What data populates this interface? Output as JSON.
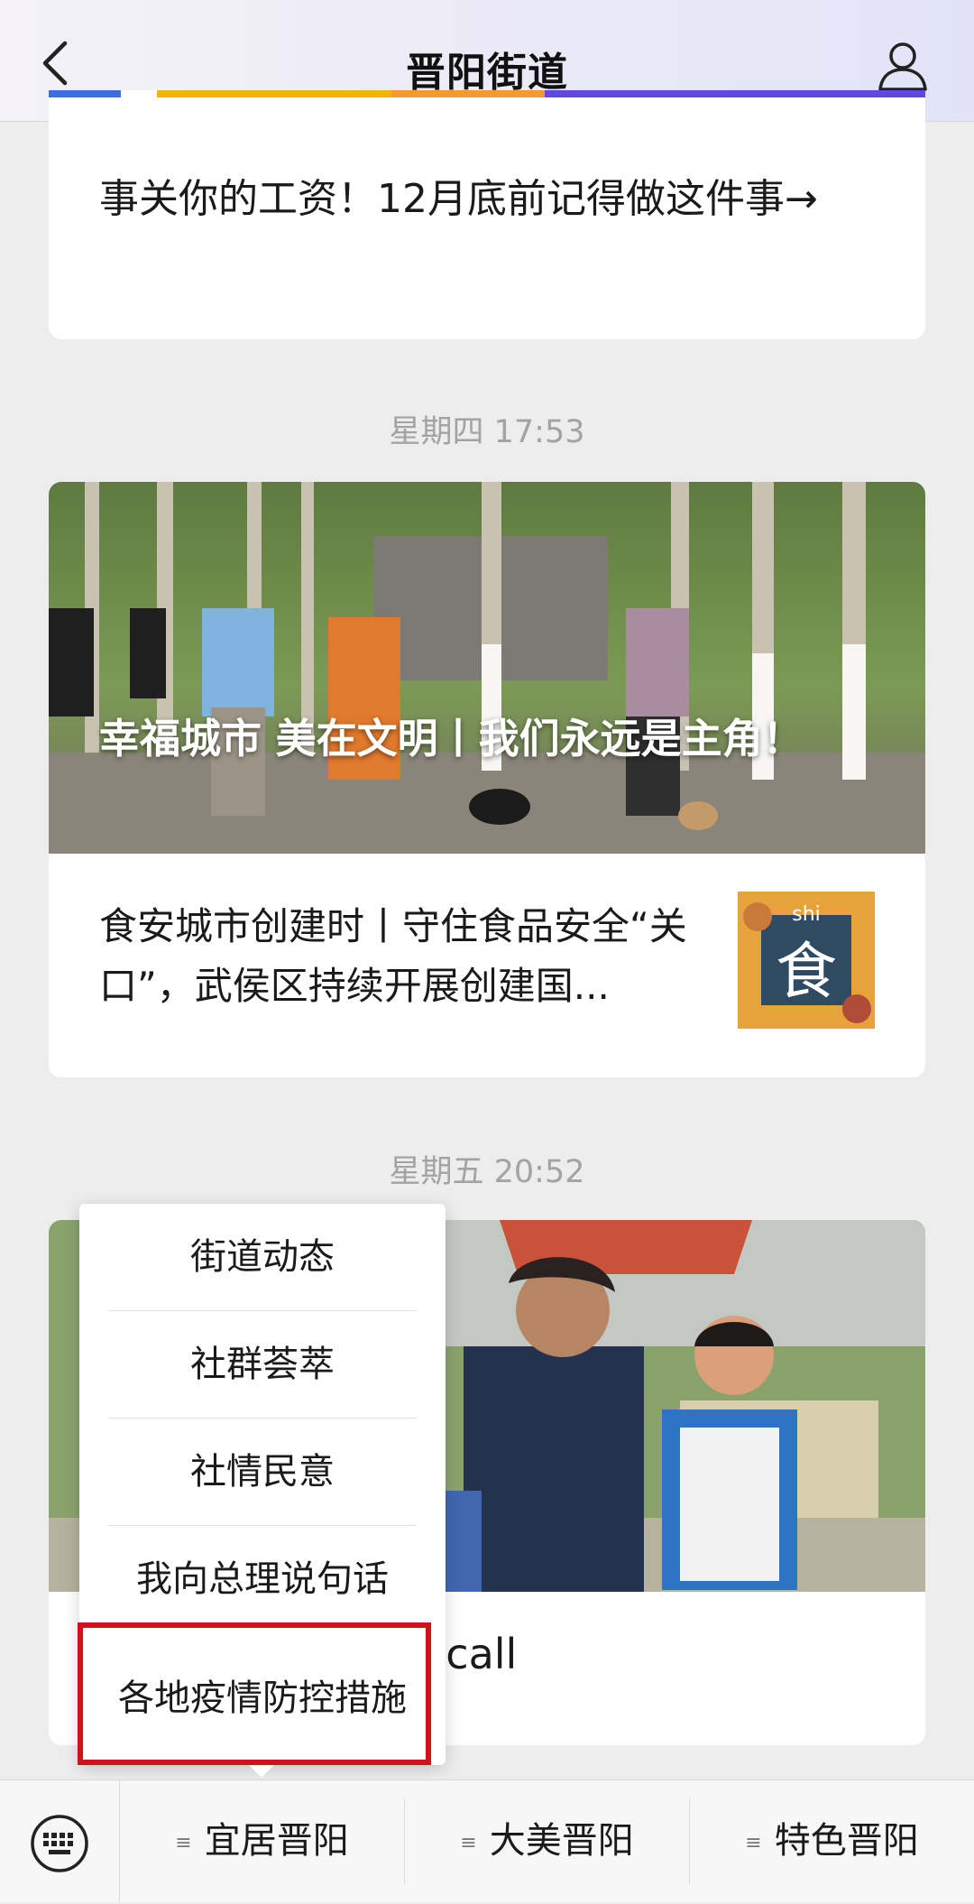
{
  "header": {
    "title": "晋阳街道"
  },
  "card1": {
    "headline": "事关你的工资！12月底前记得做这件事→"
  },
  "timestamps": [
    "星期四 17:53",
    "星期五 20:52"
  ],
  "card2": {
    "overlay_title": "幸福城市 美在文明丨我们永远是主角！",
    "sub_title": "食安城市创建时丨守住食品安全“关口”，武侯区持续开展创建国...",
    "thumb_text": "shi",
    "thumb_glyph": "食"
  },
  "card3": {
    "caption": "晋阳“共享奶奶”打 call"
  },
  "popup_menu": {
    "items": [
      "街道动态",
      "社群荟萃",
      "社情民意",
      "我向总理说句话",
      "各地疫情防控措施"
    ]
  },
  "bottom_menu": {
    "tabs": [
      "宜居晋阳",
      "大美晋阳",
      "特色晋阳"
    ]
  },
  "colors": {
    "highlight": "#d0121b",
    "timestamp": "#a3a3a3"
  }
}
